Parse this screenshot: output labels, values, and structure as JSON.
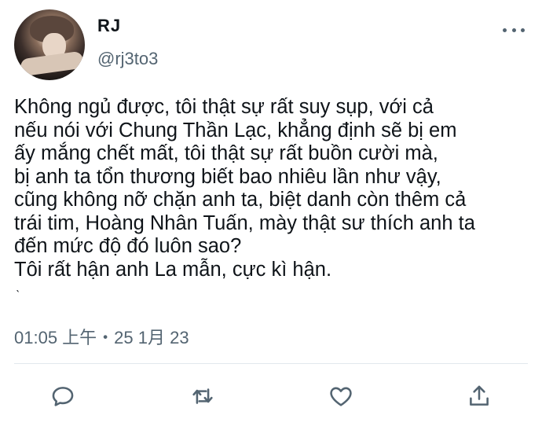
{
  "user": {
    "display_name": "RJ",
    "handle": "@rj3to3",
    "avatar_icon": "user-avatar"
  },
  "tweet": {
    "text": "Không ngủ được, tôi thật sự rất suy sụp, với cả\nnếu nói với Chung Thần Lạc, khẳng định sẽ bị em\nấy mắng chết mất, tôi thật sự rất buồn cười mà,\nbị anh ta tổn thương biết bao nhiêu lần như vậy,\ncũng không nỡ chặn anh ta, biệt danh còn thêm cả\ntrái tim, Hoàng Nhân Tuấn, mày thật sư thích anh ta\nđến mức độ đó luôn sao?\nTôi rất hận anh La mẫn, cực kì hận.",
    "stray_mark": "ˋ",
    "timestamp": "01:05 上午・25 1月 23"
  },
  "actions": [
    {
      "name": "reply",
      "icon": "reply-icon"
    },
    {
      "name": "retweet",
      "icon": "retweet-icon"
    },
    {
      "name": "like",
      "icon": "heart-icon"
    },
    {
      "name": "share",
      "icon": "share-icon"
    }
  ],
  "colors": {
    "text": "#0f1419",
    "secondary": "#536471",
    "divider": "#e1e8ed"
  }
}
